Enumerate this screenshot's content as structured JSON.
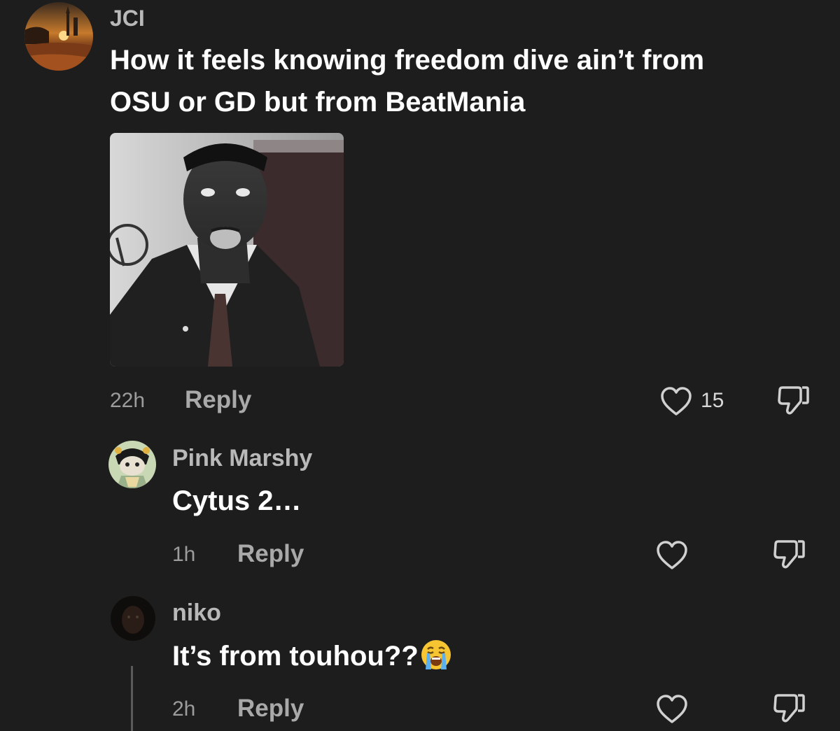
{
  "comment": {
    "author": "JCI",
    "text_line1": "How it feels knowing freedom dive ain’t from",
    "text_line2": "OSU or GD but from BeatMania",
    "time": "22h",
    "reply_label": "Reply",
    "like_count": "15",
    "like_icon": "heart-outline-icon",
    "dislike_icon": "thumbs-down-icon"
  },
  "replies": [
    {
      "author": "Pink Marshy",
      "text": "Cytus 2…",
      "time": "1h",
      "reply_label": "Reply"
    },
    {
      "author": "niko",
      "text": "It’s from touhou??",
      "emoji": "loudly-crying-face-emoji",
      "time": "2h",
      "reply_label": "Reply"
    }
  ],
  "colors": {
    "background": "#1d1d1d",
    "username": "#b9b9b9",
    "text": "#ffffff",
    "muted": "#9c9c9c"
  }
}
